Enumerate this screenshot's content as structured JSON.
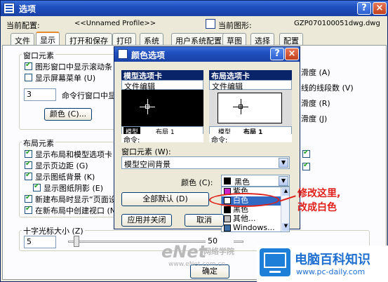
{
  "window": {
    "title": "选项"
  },
  "profile": {
    "current_profile_label": "当前配置:",
    "current_profile_value": "<<Unnamed Profile>>",
    "current_drawing_label": "当前图形:",
    "current_drawing_value": "GZP070100051dwg.dwg"
  },
  "tabs": [
    "文件",
    "显示",
    "打开和保存",
    "打印",
    "系统",
    "用户系统配置",
    "草图",
    "选择",
    "配置"
  ],
  "window_elements": {
    "heading": "窗口元素",
    "items": [
      "图形窗口中显示滚动条 (S)",
      "显示屏幕菜单 (U)"
    ],
    "cmd_lines_value": "3",
    "cmd_lines_label": "命令行窗口中显",
    "color_button": "颜色 (C)..."
  },
  "right_options": [
    "滑度 (A)",
    "线的线段数 (V)",
    "滑度 (R)",
    "滑度 (J)"
  ],
  "layout_elements": {
    "heading": "布局元素",
    "items": [
      "显示布局和模型选项卡 (L)",
      "显示页边距 (G)",
      "显示图纸背景 (K)",
      "显示图纸阴影 (E)",
      "新建布局时显示“页面设",
      "在新布局中创建视口 (N)"
    ]
  },
  "crosshair": {
    "heading": "十字光标大小 (Z)",
    "value": "5",
    "slider_value": "50"
  },
  "main_buttons": {
    "ok": "确定"
  },
  "dialog": {
    "title": "颜色选项",
    "model_tab_header": "模型选项卡",
    "layout_tab_header": "布局选项卡",
    "text_edit": "文件编辑",
    "preview_model_tabs": [
      "模型",
      "布局 1"
    ],
    "preview_layout_tabs": [
      "模型",
      "布局 1"
    ],
    "command_label": "命令:",
    "window_element_label": "窗口元素 (W):",
    "window_element_value": "模型空间背景",
    "color_label": "颜色 (C):",
    "color_value": "黑色",
    "color_options": [
      {
        "label": "紫色",
        "swatch": "#cc22cc"
      },
      {
        "label": "白色",
        "swatch": "#ffffff"
      },
      {
        "label": "黑色",
        "swatch": "#000000"
      },
      {
        "label": "其他...",
        "swatch": "#c0c0c0"
      },
      {
        "label": "Windows...",
        "swatch": "#3a6ea5"
      }
    ],
    "default_all_button": "全部默认 (D)",
    "apply_close_button": "应用并关闭",
    "cancel_button": "取消"
  },
  "annotation": {
    "line1": "修改这里,",
    "line2": "改成白色"
  },
  "watermark": {
    "logo": "eNet",
    "site_cn": "电脑百科知识",
    "site_url": "www.pc-daily.com",
    "small": "网络学院",
    "small_url": "www.eNet.com.cn"
  },
  "colors": {
    "title_bar": "#1f4fbf",
    "dialog_header": "#0a246a",
    "annotation": "#e0201a",
    "highlight": "#316ac5"
  }
}
